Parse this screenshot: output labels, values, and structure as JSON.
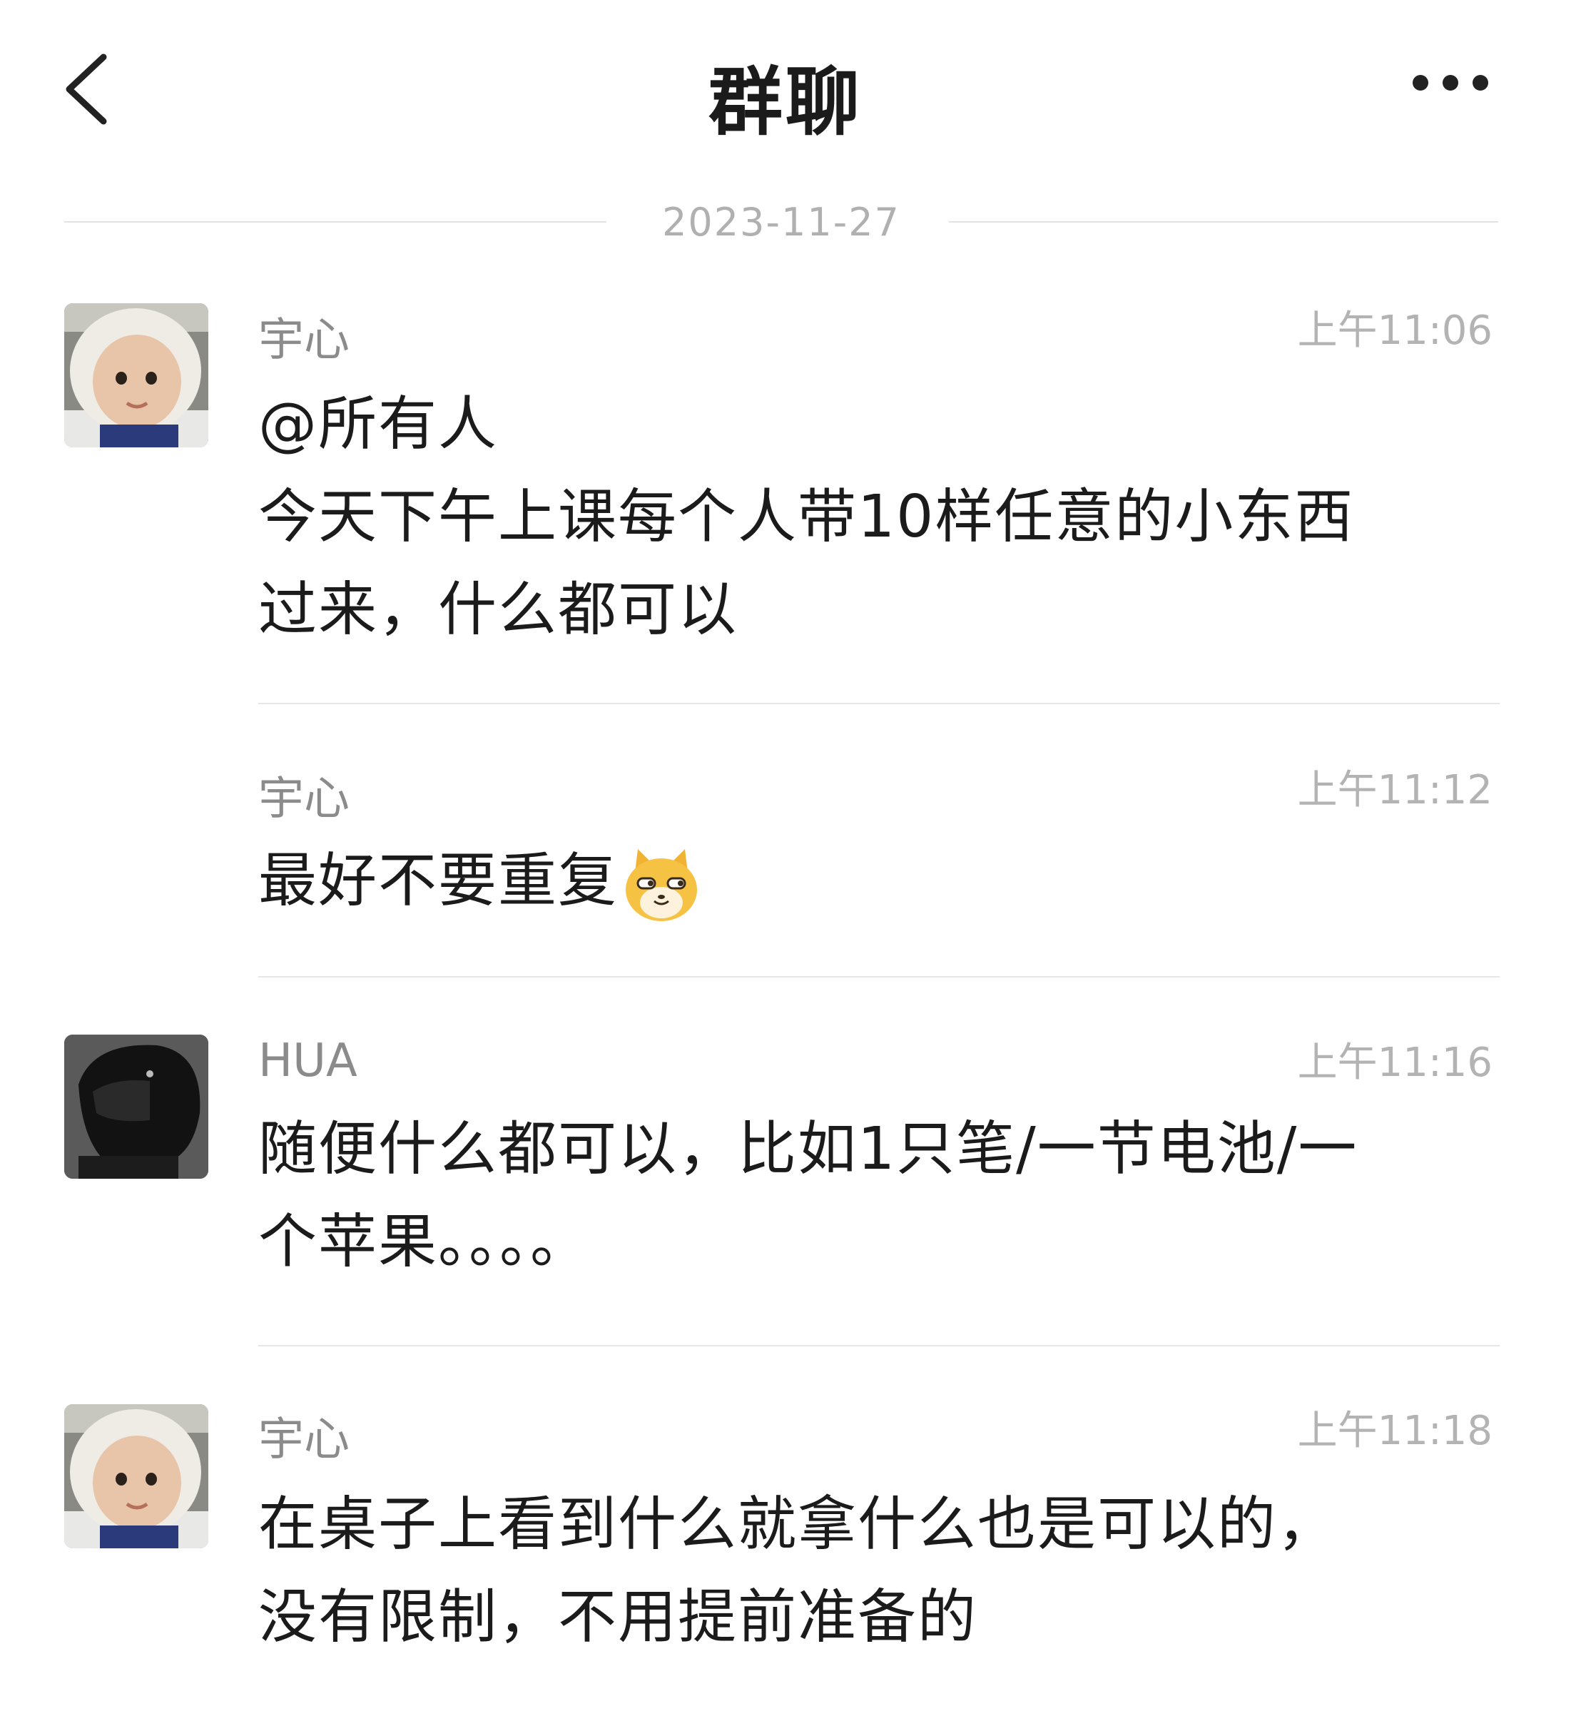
{
  "header": {
    "title": "群聊",
    "back_icon": "chevron-left-icon",
    "more_icon": "more-dots-icon"
  },
  "date_separator": "2023-11-27",
  "messages": [
    {
      "sender": "宇心",
      "time": "上午11:06",
      "text": "@所有人\n今天下午上课每个人带10样任意的小东西\n过来，什么都可以",
      "avatar": "baby-avatar"
    },
    {
      "sender": "宇心",
      "time": "上午11:12",
      "text": "最好不要重复",
      "emoji": "cat-smirk-emoji"
    },
    {
      "sender": "HUA",
      "time": "上午11:16",
      "text": "随便什么都可以，比如1只笔/一节电池/一\n个苹果。。。。",
      "avatar": "helmet-avatar"
    },
    {
      "sender": "宇心",
      "time": "上午11:18",
      "text": "在桌子上看到什么就拿什么也是可以的，\n没有限制，不用提前准备的",
      "avatar": "baby-avatar"
    }
  ],
  "colors": {
    "text": "#1b1b1b",
    "name": "#8b8b8b",
    "time": "#b3b3b3",
    "divider": "#e6e6e6",
    "background": "#ffffff"
  }
}
